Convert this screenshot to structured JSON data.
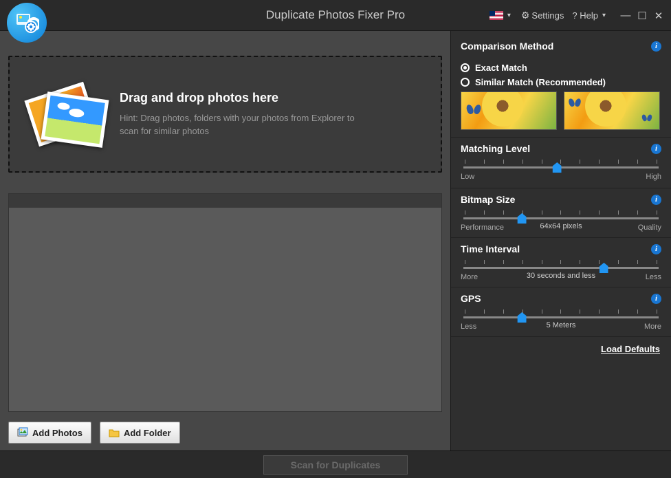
{
  "title": "Duplicate Photos Fixer Pro",
  "toolbar": {
    "settings": "Settings",
    "help": "? Help"
  },
  "dropzone": {
    "heading": "Drag and drop photos here",
    "hint": "Hint: Drag photos, folders with your photos from Explorer to scan for similar photos"
  },
  "buttons": {
    "add_photos": "Add Photos",
    "add_folder": "Add Folder"
  },
  "scan_button": "Scan for Duplicates",
  "panel": {
    "comparison": {
      "title": "Comparison Method",
      "exact": "Exact Match",
      "similar": "Similar Match (Recommended)",
      "selected": "exact"
    },
    "matching": {
      "title": "Matching Level",
      "low": "Low",
      "high": "High",
      "position_pct": 48
    },
    "bitmap": {
      "title": "Bitmap Size",
      "low": "Performance",
      "high": "Quality",
      "value_label": "64x64 pixels",
      "position_pct": 30
    },
    "time": {
      "title": "Time Interval",
      "low": "More",
      "high": "Less",
      "value_label": "30 seconds and less",
      "position_pct": 72
    },
    "gps": {
      "title": "GPS",
      "low": "Less",
      "high": "More",
      "value_label": "5 Meters",
      "position_pct": 30
    },
    "load_defaults": "Load Defaults"
  }
}
